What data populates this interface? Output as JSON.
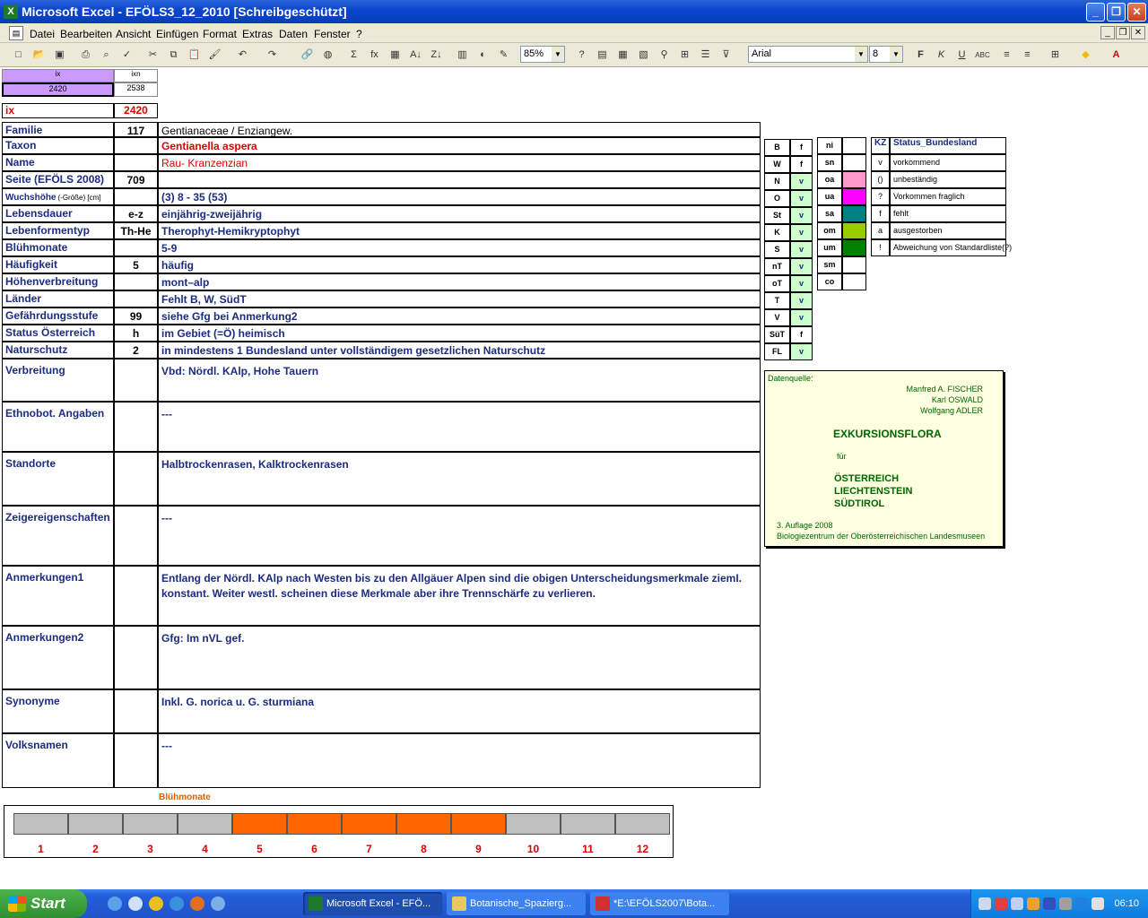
{
  "window": {
    "title": "Microsoft Excel - EFÖLS3_12_2010  [Schreibgeschützt]"
  },
  "menu": [
    "Datei",
    "Bearbeiten",
    "Ansicht",
    "Einfügen",
    "Format",
    "Extras",
    "Daten",
    "Fenster",
    "?"
  ],
  "toolbar": {
    "zoom": "85%",
    "font": "Arial",
    "size": "8"
  },
  "top": {
    "ix_label": "ix",
    "ixn_label": "ixn",
    "ix_value": "2420",
    "ixn_value": "2538",
    "ix2_label": "ix",
    "ix2_value": "2420"
  },
  "rows": [
    {
      "label": "Familie",
      "num": "117",
      "value": "Gentianaceae  /  Enziangew."
    },
    {
      "label": "Taxon",
      "num": "",
      "value": "Gentianella aspera"
    },
    {
      "label": "Name",
      "num": "",
      "value": "Rau- Kranzenzian"
    },
    {
      "label": "Seite (EFÖLS 2008)",
      "num": "709",
      "value": ""
    },
    {
      "label": "Wuchshöhe",
      "label_small": "(-Größe) [cm]",
      "num": "",
      "value": "(3) 8 - 35 (53)"
    },
    {
      "label": "Lebensdauer",
      "num": "e-z",
      "value": "einjährig-zweijährig"
    },
    {
      "label": "Lebenformentyp",
      "num": "Th-He",
      "value": "Therophyt-Hemikryptophyt"
    },
    {
      "label": "Blühmonate",
      "num": "",
      "value": "5-9"
    },
    {
      "label": "Häufigkeit",
      "num": "5",
      "value": "häufig"
    },
    {
      "label": "Höhenverbreitung",
      "num": "",
      "value": "mont–alp"
    },
    {
      "label": "Länder",
      "num": "",
      "value": "Fehlt B, W, SüdT"
    },
    {
      "label": "Gefährdungsstufe",
      "num": "99",
      "value": "siehe Gfg bei Anmerkung2"
    },
    {
      "label": "Status Österreich",
      "num": "h",
      "value": "im Gebiet (=Ö) heimisch"
    },
    {
      "label": "Naturschutz",
      "num": "2",
      "value": "in mindestens 1 Bundesland unter vollständigem gesetzlichen Naturschutz"
    },
    {
      "label": "Verbreitung",
      "num": "",
      "value": "Vbd:  Nördl. KAlp, Hohe Tauern"
    },
    {
      "label": "Ethnobot. Angaben",
      "num": "",
      "value": "---"
    },
    {
      "label": "Standorte",
      "num": "",
      "value": "Halbtrockenrasen, Kalktrockenrasen"
    },
    {
      "label": "Zeigereigenschaften",
      "num": "",
      "value": "---"
    },
    {
      "label": "Anmerkungen1",
      "num": "",
      "value": "Entlang der Nördl. KAlp nach Westen bis zu den Allgäuer Alpen sind die obigen Unterscheidungsmerkmale ziemI.",
      "value2": "konstant. Weiter westl. scheinen diese Merkmale aber ihre Trennschärfe zu verlieren."
    },
    {
      "label": "Anmerkungen2",
      "num": "",
      "value": "Gfg: Im nVL gef."
    },
    {
      "label": "Synonyme",
      "num": "",
      "value": "Inkl. G. norica u. G. sturmiana"
    },
    {
      "label": "Volksnamen",
      "num": "",
      "value": "---"
    }
  ],
  "laender": [
    {
      "code": "B",
      "val": "f"
    },
    {
      "code": "W",
      "val": "f"
    },
    {
      "code": "N",
      "val": "v"
    },
    {
      "code": "O",
      "val": "v"
    },
    {
      "code": "St",
      "val": "v"
    },
    {
      "code": "K",
      "val": "v"
    },
    {
      "code": "S",
      "val": "v"
    },
    {
      "code": "nT",
      "val": "v"
    },
    {
      "code": "oT",
      "val": "v"
    },
    {
      "code": "T",
      "val": "v"
    },
    {
      "code": "V",
      "val": "v"
    },
    {
      "code": "SüT",
      "val": "f"
    },
    {
      "code": "FL",
      "val": "v"
    }
  ],
  "regions": [
    {
      "code": "ni",
      "color": "#ffffff"
    },
    {
      "code": "sn",
      "color": "#ffffff"
    },
    {
      "code": "oa",
      "color": "#ff99cc"
    },
    {
      "code": "ua",
      "color": "#ff00ff"
    },
    {
      "code": "sa",
      "color": "#008080"
    },
    {
      "code": "om",
      "color": "#99cc00"
    },
    {
      "code": "um",
      "color": "#008000"
    },
    {
      "code": "sm",
      "color": "#ffffff"
    },
    {
      "code": "co",
      "color": "#ffffff"
    }
  ],
  "kz": {
    "header_kz": "KZ",
    "header_status": "Status_Bundesland",
    "items": [
      {
        "kz": "v",
        "text": "vorkommend"
      },
      {
        "kz": "()",
        "text": "unbeständig"
      },
      {
        "kz": "?",
        "text": "Vorkommen fraglich"
      },
      {
        "kz": "f",
        "text": "fehlt"
      },
      {
        "kz": "a",
        "text": "ausgestorben"
      },
      {
        "kz": "!",
        "text": "Abweichung von Standardliste(?)"
      }
    ]
  },
  "source": {
    "label": "Datenquelle:",
    "authors": [
      "Manfred A. FISCHER",
      "Karl OSWALD",
      "Wolfgang ADLER"
    ],
    "title": "EXKURSIONSFLORA",
    "fuer": "für",
    "countries": [
      "ÖSTERREICH",
      "LIECHTENSTEIN",
      "SÜDTIROL"
    ],
    "edition": "3. Auflage 2008",
    "publisher": "Biologiezentrum der Oberösterreichischen Landesmuseen"
  },
  "bloom": {
    "title": "Blühmonate",
    "months": [
      "1",
      "2",
      "3",
      "4",
      "5",
      "6",
      "7",
      "8",
      "9",
      "10",
      "11",
      "12"
    ],
    "active": [
      false,
      false,
      false,
      false,
      true,
      true,
      true,
      true,
      true,
      false,
      false,
      false
    ],
    "colors": {
      "active": "#ff6600",
      "inactive": "#c0c0c0"
    }
  },
  "taskbar": {
    "start": "Start",
    "tasks": [
      "Microsoft Excel - EFÖ...",
      "Botanische_Spazierg...",
      "*E:\\EFÖLS2007\\Bota..."
    ],
    "clock": "06:10"
  },
  "colors": {
    "label": "#1c2c80",
    "red": "#e00000",
    "green": "#006600"
  }
}
